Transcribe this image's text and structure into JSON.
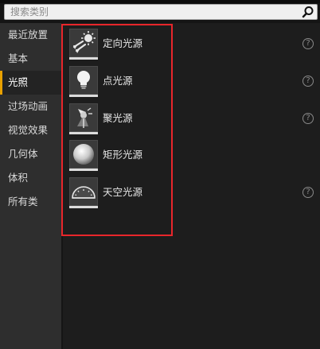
{
  "search": {
    "placeholder": "搜索类别"
  },
  "sidebar": {
    "items": [
      {
        "label": "最近放置"
      },
      {
        "label": "基本"
      },
      {
        "label": "光照"
      },
      {
        "label": "过场动画"
      },
      {
        "label": "视觉效果"
      },
      {
        "label": "几何体"
      },
      {
        "label": "体积"
      },
      {
        "label": "所有类"
      }
    ],
    "selected": "光照"
  },
  "lights": {
    "items": [
      {
        "label": "定向光源",
        "icon": "directional-light-icon"
      },
      {
        "label": "点光源",
        "icon": "point-light-icon"
      },
      {
        "label": "聚光源",
        "icon": "spot-light-icon"
      },
      {
        "label": "矩形光源",
        "icon": "rect-light-icon"
      },
      {
        "label": "天空光源",
        "icon": "sky-light-icon"
      }
    ]
  },
  "help_glyph": "?",
  "colors": {
    "accent": "#e9a100",
    "highlight": "#e8262b"
  }
}
